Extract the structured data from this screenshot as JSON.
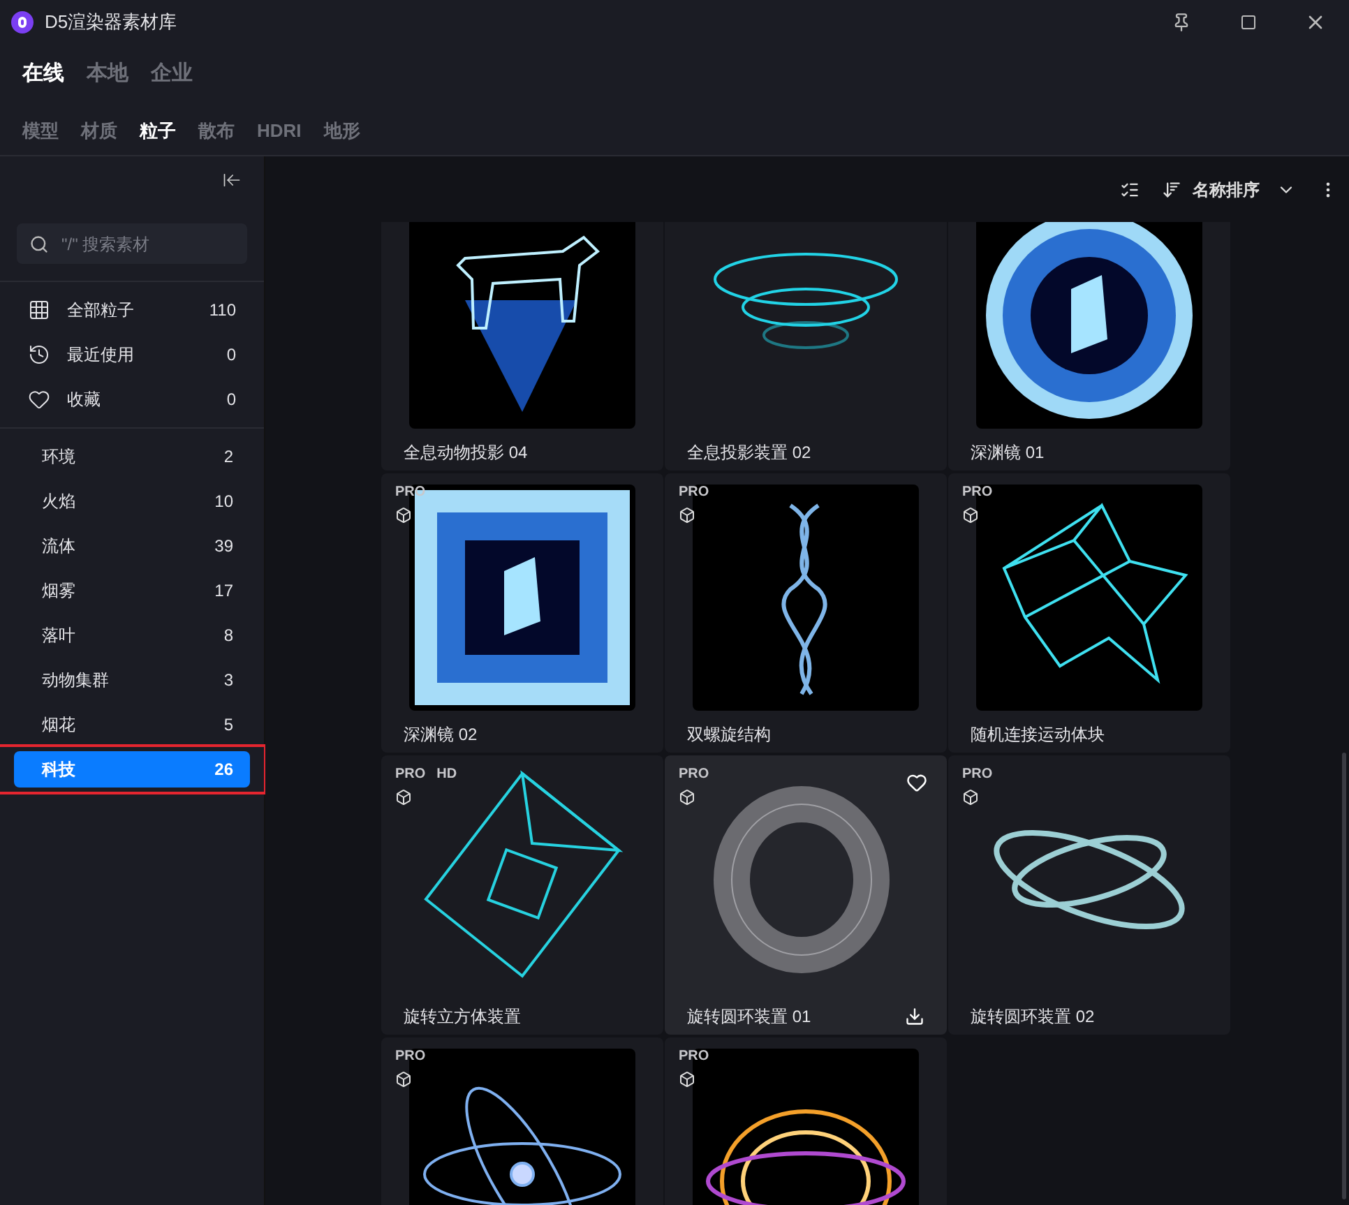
{
  "window": {
    "title": "D5渲染器素材库"
  },
  "source_tabs": [
    {
      "label": "在线",
      "selected": true
    },
    {
      "label": "本地",
      "selected": false
    },
    {
      "label": "企业",
      "selected": false
    }
  ],
  "type_tabs": [
    {
      "label": "模型",
      "selected": false
    },
    {
      "label": "材质",
      "selected": false
    },
    {
      "label": "粒子",
      "selected": true
    },
    {
      "label": "散布",
      "selected": false
    },
    {
      "label": "HDRI",
      "selected": false
    },
    {
      "label": "地形",
      "selected": false
    }
  ],
  "sidebar": {
    "search": {
      "placeholder": "\"/\" 搜索素材"
    },
    "quick_items": [
      {
        "kind": "all",
        "label": "全部粒子",
        "count": "110"
      },
      {
        "kind": "recent",
        "label": "最近使用",
        "count": "0"
      },
      {
        "kind": "favorite",
        "label": "收藏",
        "count": "0"
      }
    ],
    "categories": [
      {
        "label": "环境",
        "count": "2",
        "selected": false
      },
      {
        "label": "火焰",
        "count": "10",
        "selected": false
      },
      {
        "label": "流体",
        "count": "39",
        "selected": false
      },
      {
        "label": "烟雾",
        "count": "17",
        "selected": false
      },
      {
        "label": "落叶",
        "count": "8",
        "selected": false
      },
      {
        "label": "动物集群",
        "count": "3",
        "selected": false
      },
      {
        "label": "烟花",
        "count": "5",
        "selected": false
      },
      {
        "label": "科技",
        "count": "26",
        "selected": true,
        "highlighted": true
      }
    ]
  },
  "toolbar": {
    "sort": "名称排序"
  },
  "assets": [
    {
      "title": "全息动物投影 04",
      "kind": "dog",
      "hovered": false
    },
    {
      "title": "全息投影装置 02",
      "kind": "rings",
      "hovered": false
    },
    {
      "title": "深渊镜 01",
      "kind": "portal-circle",
      "hovered": false
    },
    {
      "title": "深渊镜 02",
      "badges": [
        "PRO"
      ],
      "kind": "portal-square",
      "hovered": false
    },
    {
      "title": "双螺旋结构",
      "badges": [
        "PRO"
      ],
      "kind": "dna",
      "hovered": false
    },
    {
      "title": "随机连接运动体块",
      "badges": [
        "PRO"
      ],
      "kind": "network",
      "hovered": false
    },
    {
      "title": "旋转立方体装置",
      "badges": [
        "PRO",
        "HD"
      ],
      "kind": "cube",
      "hovered": false
    },
    {
      "title": "旋转圆环装置 01",
      "badges": [
        "PRO"
      ],
      "kind": "torus",
      "hovered": true
    },
    {
      "title": "旋转圆环装置 02",
      "badges": [
        "PRO"
      ],
      "kind": "orbits",
      "hovered": false
    },
    {
      "badges": [
        "PRO"
      ],
      "kind": "atom",
      "hovered": false
    },
    {
      "badges": [
        "PRO"
      ],
      "kind": "fire",
      "hovered": false
    }
  ]
}
